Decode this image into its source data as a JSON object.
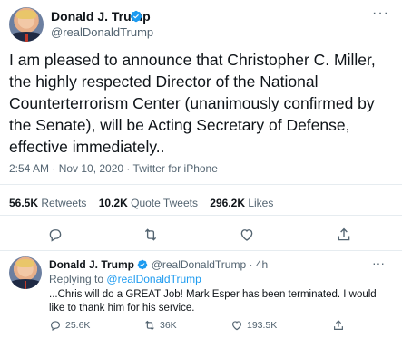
{
  "tweet": {
    "name": "Donald J. Trump",
    "handle": "@realDonaldTrump",
    "text": "I am pleased to announce that Christopher C. Miller,\nthe highly respected Director of the National\nCounterterrorism Center (unanimously confirmed by\nthe Senate), will be Acting Secretary of Defense,\neffective immediately..",
    "meta": "2:54 AM · Nov 10, 2020 · Twitter for iPhone",
    "stats": {
      "retweets_count": "56.5K",
      "retweets_label": "Retweets",
      "quotes_count": "10.2K",
      "quotes_label": "Quote Tweets",
      "likes_count": "296.2K",
      "likes_label": "Likes"
    }
  },
  "reply": {
    "name": "Donald J. Trump",
    "handle": "@realDonaldTrump",
    "dot": "·",
    "time": "4h",
    "replying_prefix": "Replying to",
    "replying_handle": "@realDonaldTrump",
    "text": "...Chris will do a GREAT Job! Mark Esper has been terminated. I would like to thank him for his service.",
    "counts": {
      "replies": "25.6K",
      "retweets": "36K",
      "likes": "193.5K"
    }
  },
  "icons": {
    "verified": "verified-badge-icon",
    "more": "more-icon",
    "reply": "reply-icon",
    "retweet": "retweet-icon",
    "like": "like-icon",
    "share": "share-icon"
  },
  "colors": {
    "accent": "#1d9bf0",
    "muted": "#536471",
    "text": "#0f1419",
    "divider": "#e6ecf0"
  }
}
